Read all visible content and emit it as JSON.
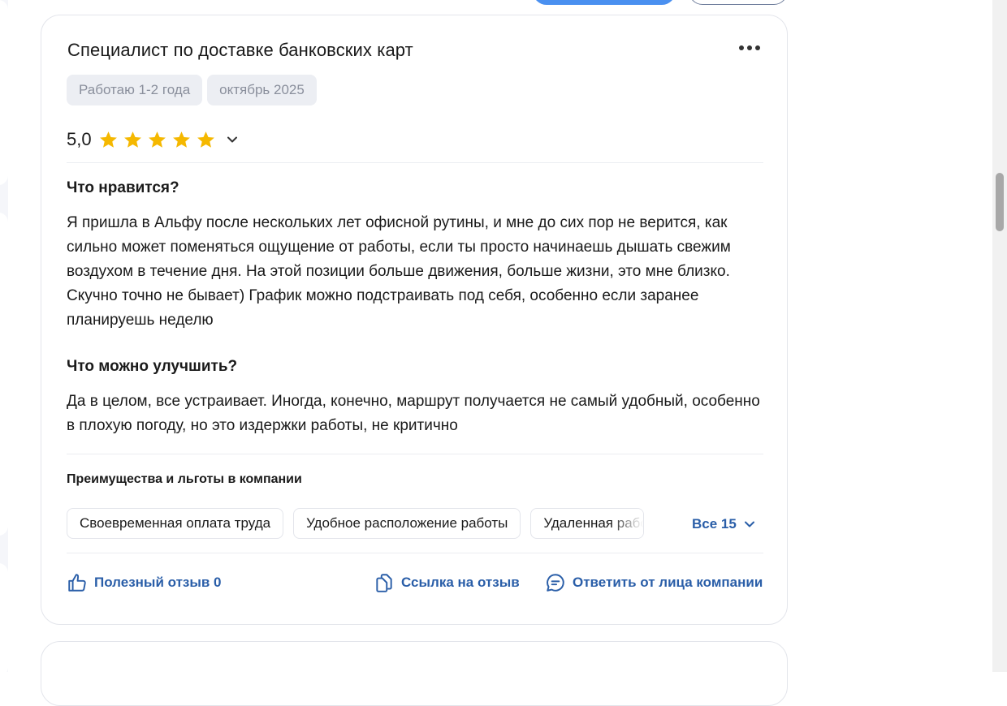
{
  "review": {
    "title": "Специалист по доставке банковских карт",
    "tags": [
      "Работаю 1-2 года",
      "октябрь 2025"
    ],
    "rating_value": "5,0",
    "stars_filled": 5,
    "stars_total": 5,
    "likes": {
      "heading": "Что нравится?",
      "text": "Я пришла в Альфу после нескольких лет офисной рутины, и мне до сих пор не верится, как сильно может поменяться ощущение от работы, если ты просто начинаешь дышать свежим воздухом в течение дня. На этой позиции больше движения, больше жизни, это мне близко. Скучно точно не бывает) График можно подстраивать под себя, особенно если заранее планируешь неделю"
    },
    "improve": {
      "heading": "Что можно улучшить?",
      "text": "Да в целом, все устраивает. Иногда, конечно, маршрут получается не самый удобный, особенно в плохую погоду, но это издержки работы, не критично"
    },
    "benefits": {
      "heading": "Преимущества и льготы в компании",
      "items": [
        "Своевременная оплата труда",
        "Удобное расположение работы",
        "Удаленная работа"
      ],
      "all_label": "Все 15"
    },
    "actions": {
      "useful": "Полезный отзыв 0",
      "link": "Ссылка на отзыв",
      "reply": "Ответить от лица компании"
    }
  },
  "colors": {
    "accent": "#2a5ea8",
    "star": "#f5b800",
    "chip_bg": "#eceef3"
  }
}
